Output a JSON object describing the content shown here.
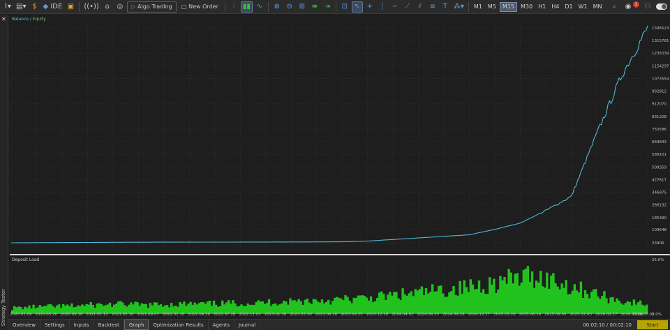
{
  "toolbar": {
    "ide_label": "IDE",
    "algo_trading_label": "Algo Trading",
    "new_order_label": "New Order",
    "timeframes": [
      "M1",
      "M5",
      "M15",
      "M30",
      "H1",
      "H4",
      "D1",
      "W1",
      "MN"
    ],
    "active_timeframe": "M15",
    "notification_count": "1"
  },
  "sidebar": {
    "panel_title": "Strategy Tester",
    "close_symbol": "✕"
  },
  "chart": {
    "legend_balance": "Balance",
    "legend_equity": "Equity",
    "load_title": "Deposit Load"
  },
  "chart_data": [
    {
      "type": "line",
      "series": [
        {
          "name": "Balance"
        },
        {
          "name": "Equity"
        }
      ],
      "x": [
        "2020.01.09",
        "2020.05.20",
        "2020.09.18",
        "2021.01.12",
        "2021.05.18",
        "2021.09.07",
        "2022.01.10",
        "2022.04.29",
        "2022.07.28",
        "2022.11.02",
        "2023.01.16",
        "2023.03.30",
        "2023.06.28",
        "2023.09.25",
        "2023.12.28",
        "2024.04.02",
        "2024.06.25",
        "2024.09.26",
        "2024.12.27",
        "2025.03.26",
        "2025.06.16",
        "2025.09.05",
        "2025.12.03",
        "2026.02.17",
        "2026.05.06",
        "2026.07.05"
      ],
      "values": [
        23906,
        24800,
        25500,
        26200,
        27000,
        27500,
        28000,
        28200,
        28300,
        28500,
        28800,
        29200,
        29600,
        30000,
        35000,
        45000,
        55000,
        65000,
        75000,
        109648,
        150000,
        230000,
        320000,
        720000,
        1100000,
        1396523
      ],
      "y_ticks": [
        "1396523",
        "1315781",
        "1235039",
        "1154297",
        "1073554",
        "992812",
        "912070",
        "831328",
        "750586",
        "669843",
        "589101",
        "508359",
        "427617",
        "346875",
        "266132",
        "185390",
        "109648",
        "23906"
      ],
      "ylim": [
        23906,
        1396523
      ]
    },
    {
      "type": "bar",
      "title": "Deposit Load",
      "y_ticks": [
        "25.0%",
        "0.0%"
      ],
      "ylim": [
        0,
        25
      ],
      "values": [
        3.0,
        3.5,
        3.8,
        4.0,
        4.5,
        4.8,
        5.0,
        4.5,
        4.8,
        5.0,
        5.0,
        5.2,
        5.5,
        5.5,
        6.0,
        6.5,
        6.8,
        7.0,
        7.5,
        8.0,
        9.0,
        10.0,
        11.0,
        12.0,
        13.0,
        14.5,
        16.0,
        18.0,
        19.5,
        17.0,
        14.0,
        11.0,
        8.0,
        6.0,
        5.0
      ]
    }
  ],
  "bottom_tabs": [
    "Overview",
    "Settings",
    "Inputs",
    "Backtest",
    "Graph",
    "Optimization Results",
    "Agents",
    "Journal"
  ],
  "active_tab": "Graph",
  "timer": "00:02:10 / 00:02:10",
  "start_label": "Start",
  "colors": {
    "balance": "#4fb8d8",
    "deposit_load": "#22c21e",
    "grid": "#2f2f2f",
    "accent": "#b8a400"
  }
}
